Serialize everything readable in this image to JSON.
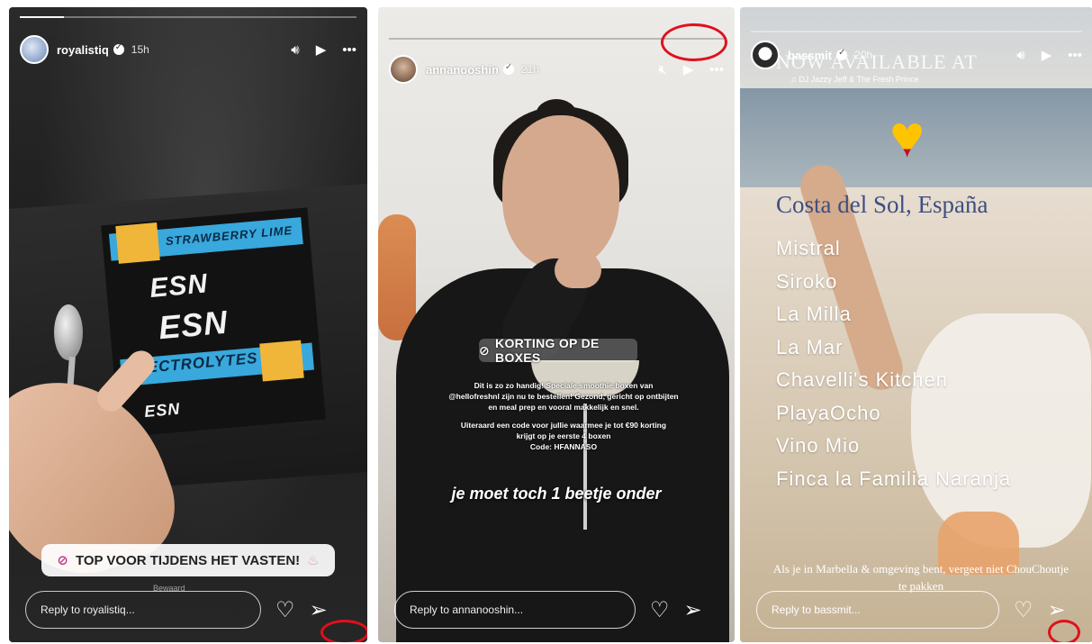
{
  "stories": [
    {
      "progress": 0.13,
      "username": "royalistiq",
      "time": "15h",
      "box_texts": [
        "STRAWBERRY LIME",
        "ESN",
        "ESN",
        "ELECTROLYTES",
        "ESN"
      ],
      "sticker": "TOP VOOR TIJDENS HET VASTEN!",
      "watermark": "Bewaard",
      "reply_placeholder": "Reply to royalistiq...",
      "accent": "#38a8dd"
    },
    {
      "progress": 0.0,
      "username": "annanooshin",
      "time": "21h",
      "korting": "KORTING OP DE BOXES",
      "overlay_lines": [
        "Dit is zo zo handig! Speciale smoothie boxen van",
        "@hellofreshnl zijn nu te bestellen! Gezond, gericht op ontbijten",
        "en meal prep en vooral makkelijk en snel.",
        "",
        "Uiteraard een code voor jullie waarmee je tot €90 korting",
        "krijgt op je eerste 4 boxen",
        "Code: HFANNASO"
      ],
      "caption": "je moet toch 1 beetje onder",
      "reply_placeholder": "Reply to annanooshin..."
    },
    {
      "progress": 0.0,
      "username": "bassmit",
      "time": "20h",
      "available": "NOW AVAILABLE AT",
      "music": "DJ Jazzy Jeff & The Fresh Prince",
      "location": "Costa del Sol, España",
      "places": [
        "Mistral",
        "Siroko",
        "La Milla",
        "La Mar",
        "Chavelli's Kitchen",
        "PlayaOcho",
        "Vino Mio",
        "Finca la Familia Naranja"
      ],
      "note": "Als je in Marbella & omgeving bent, vergeet niet ChouChoutje te pakken",
      "reply_placeholder": "Reply to bassmit..."
    }
  ],
  "colors": {
    "highlight_ring": "#e0101c",
    "spain_red": "#c60b1e",
    "spain_yellow": "#ffc400",
    "location_blue": "#3e4f80"
  },
  "icons": [
    "avatar",
    "verified-icon",
    "sound-icon",
    "play-icon",
    "more-icon",
    "heart-icon",
    "send-icon",
    "link-icon"
  ]
}
